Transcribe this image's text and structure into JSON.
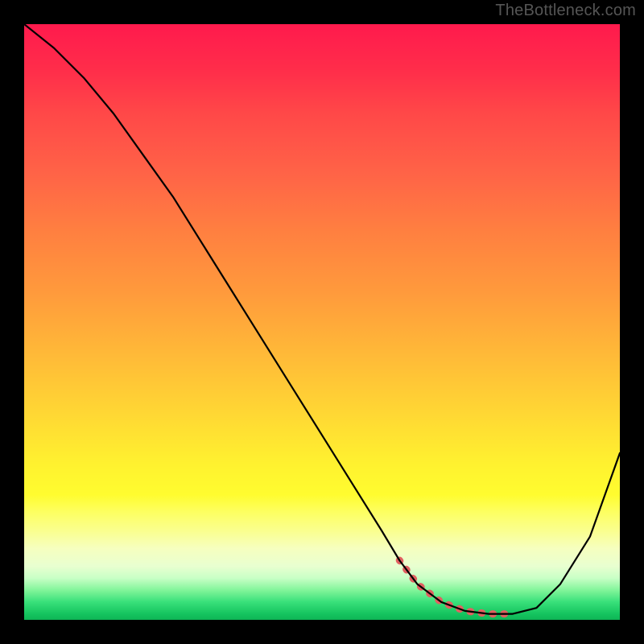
{
  "watermark": "TheBottleneck.com",
  "chart_data": {
    "type": "line",
    "title": "",
    "xlabel": "",
    "ylabel": "",
    "xlim": [
      0,
      100
    ],
    "ylim": [
      0,
      100
    ],
    "series": [
      {
        "name": "curve",
        "x": [
          0,
          5,
          10,
          15,
          20,
          25,
          30,
          35,
          40,
          45,
          50,
          55,
          60,
          63,
          66,
          70,
          74,
          78,
          80,
          82,
          86,
          90,
          95,
          100
        ],
        "values": [
          100,
          96,
          91,
          85,
          78,
          71,
          63,
          55,
          47,
          39,
          31,
          23,
          15,
          10,
          6,
          3,
          1.5,
          1,
          1,
          1,
          2,
          6,
          14,
          28
        ]
      }
    ],
    "trough_marker": {
      "x": [
        63,
        66,
        70,
        74,
        78,
        80,
        82
      ],
      "values": [
        10,
        6,
        3,
        1.5,
        1,
        1,
        1
      ]
    },
    "legend": false,
    "grid": false
  }
}
